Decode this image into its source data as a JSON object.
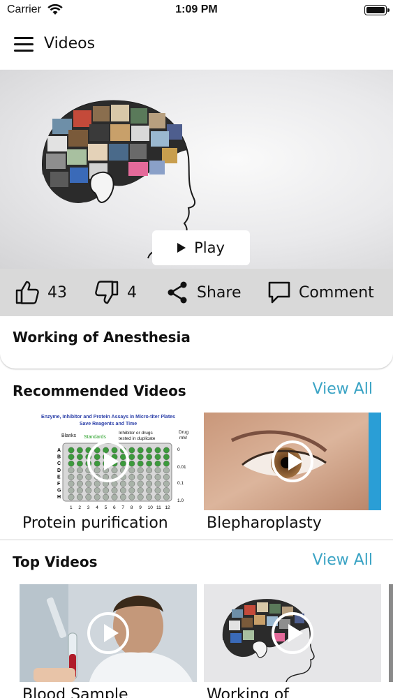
{
  "status_bar": {
    "carrier": "Carrier",
    "time": "1:09 PM"
  },
  "nav": {
    "title": "Videos"
  },
  "hero": {
    "play_label": "Play",
    "likes": "43",
    "dislikes": "4",
    "share_label": "Share",
    "comment_label": "Comment",
    "title": "Working of Anesthesia"
  },
  "recommended": {
    "title": "Recommended Videos",
    "view_all": "View All",
    "items": [
      {
        "label": "Protein purification",
        "thumb_heading": "Enzyme, Inhibitor and Protein Assays in Micro-titer Plates",
        "thumb_subheading": "Save Reagents and Time",
        "thumb_blanks": "Blanks",
        "thumb_standards": "Standards",
        "thumb_inhibitor": "Inhibitor or drugs",
        "thumb_duplicate": "tested in duplicate",
        "thumb_drug": "Drug",
        "thumb_mm": "mM",
        "thumb_rows": [
          "A",
          "B",
          "C",
          "D",
          "E",
          "F",
          "G",
          "H"
        ],
        "thumb_cols": [
          "1",
          "2",
          "3",
          "4",
          "5",
          "6",
          "7",
          "8",
          "9",
          "10",
          "11",
          "12"
        ],
        "thumb_conc": [
          "0",
          "0.01",
          "0.1",
          "1.0"
        ]
      },
      {
        "label": "Blepharoplasty"
      }
    ]
  },
  "top": {
    "title": "Top Videos",
    "view_all": "View All",
    "items": [
      {
        "label": "Blood Sample"
      },
      {
        "label": "Working of"
      }
    ]
  },
  "colors": {
    "accent": "#3aa3c4",
    "action_bar": "#d9d9d9",
    "plate_well": "#3c9a3c"
  }
}
